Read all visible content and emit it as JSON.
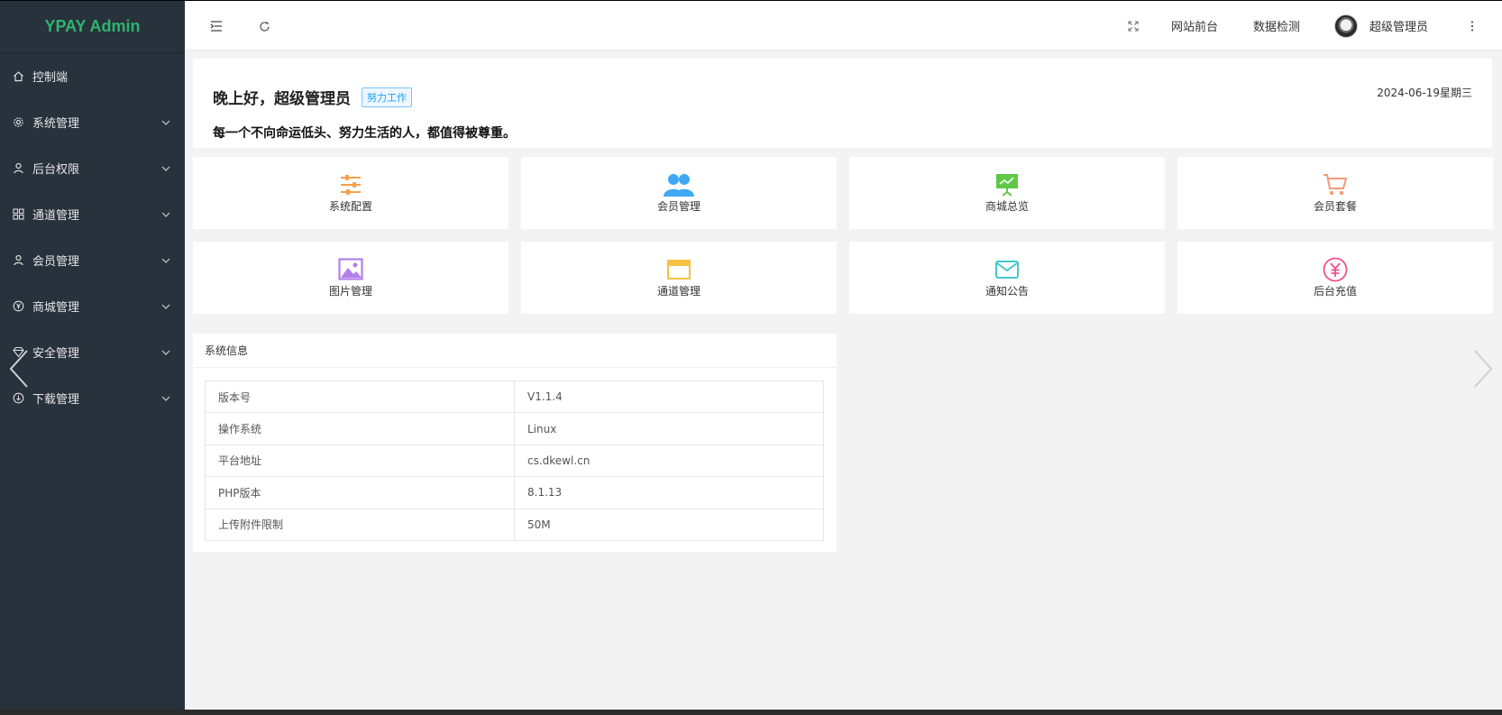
{
  "app": {
    "logo": "YPAY Admin"
  },
  "sidebar": {
    "items": [
      {
        "label": "控制端",
        "icon": "home-icon",
        "has_children": false
      },
      {
        "label": "系统管理",
        "icon": "gear-icon",
        "has_children": true
      },
      {
        "label": "后台权限",
        "icon": "user-icon",
        "has_children": true
      },
      {
        "label": "通道管理",
        "icon": "apps-icon",
        "has_children": true
      },
      {
        "label": "会员管理",
        "icon": "user-icon",
        "has_children": true
      },
      {
        "label": "商城管理",
        "icon": "yen-circle-icon",
        "has_children": true
      },
      {
        "label": "安全管理",
        "icon": "diamond-icon",
        "has_children": true
      },
      {
        "label": "下载管理",
        "icon": "download-circle-icon",
        "has_children": true
      }
    ]
  },
  "header": {
    "menu_toggle_icon": "menu-fold-icon",
    "refresh_icon": "refresh-icon",
    "fullscreen_icon": "fullscreen-icon",
    "front_label": "网站前台",
    "check_label": "数据检测",
    "user_name": "超级管理员",
    "more_icon": "more-vertical-icon"
  },
  "welcome": {
    "greeting": "晚上好，超级管理员",
    "badge": "努力工作",
    "date": "2024-06-19星期三",
    "motto": "每一个不向命运低头、努力生活的人，都值得被尊重。"
  },
  "shortcuts": [
    {
      "label": "系统配置",
      "icon": "sliders-icon",
      "color": "#f6a04d"
    },
    {
      "label": "会员管理",
      "icon": "users-icon",
      "color": "#3fa9f5"
    },
    {
      "label": "商城总览",
      "icon": "presentation-icon",
      "color": "#5fc946"
    },
    {
      "label": "会员套餐",
      "icon": "cart-icon",
      "color": "#f39a7a"
    },
    {
      "label": "图片管理",
      "icon": "image-icon",
      "color": "#b37feb"
    },
    {
      "label": "通道管理",
      "icon": "window-icon",
      "color": "#f5c242"
    },
    {
      "label": "通知公告",
      "icon": "mail-icon",
      "color": "#46c6c9"
    },
    {
      "label": "后台充值",
      "icon": "yen-circle-icon",
      "color": "#f0508a"
    }
  ],
  "system_info": {
    "title": "系统信息",
    "rows": [
      {
        "key": "版本号",
        "value": "V1.1.4"
      },
      {
        "key": "操作系统",
        "value": "Linux"
      },
      {
        "key": "平台地址",
        "value": "cs.dkewl.cn"
      },
      {
        "key": "PHP版本",
        "value": "8.1.13"
      },
      {
        "key": "上传附件限制",
        "value": "50M"
      }
    ]
  },
  "colors": {
    "sidebar_bg": "#28323c",
    "logo": "#2fb46e",
    "accent": "#1e9fff"
  }
}
